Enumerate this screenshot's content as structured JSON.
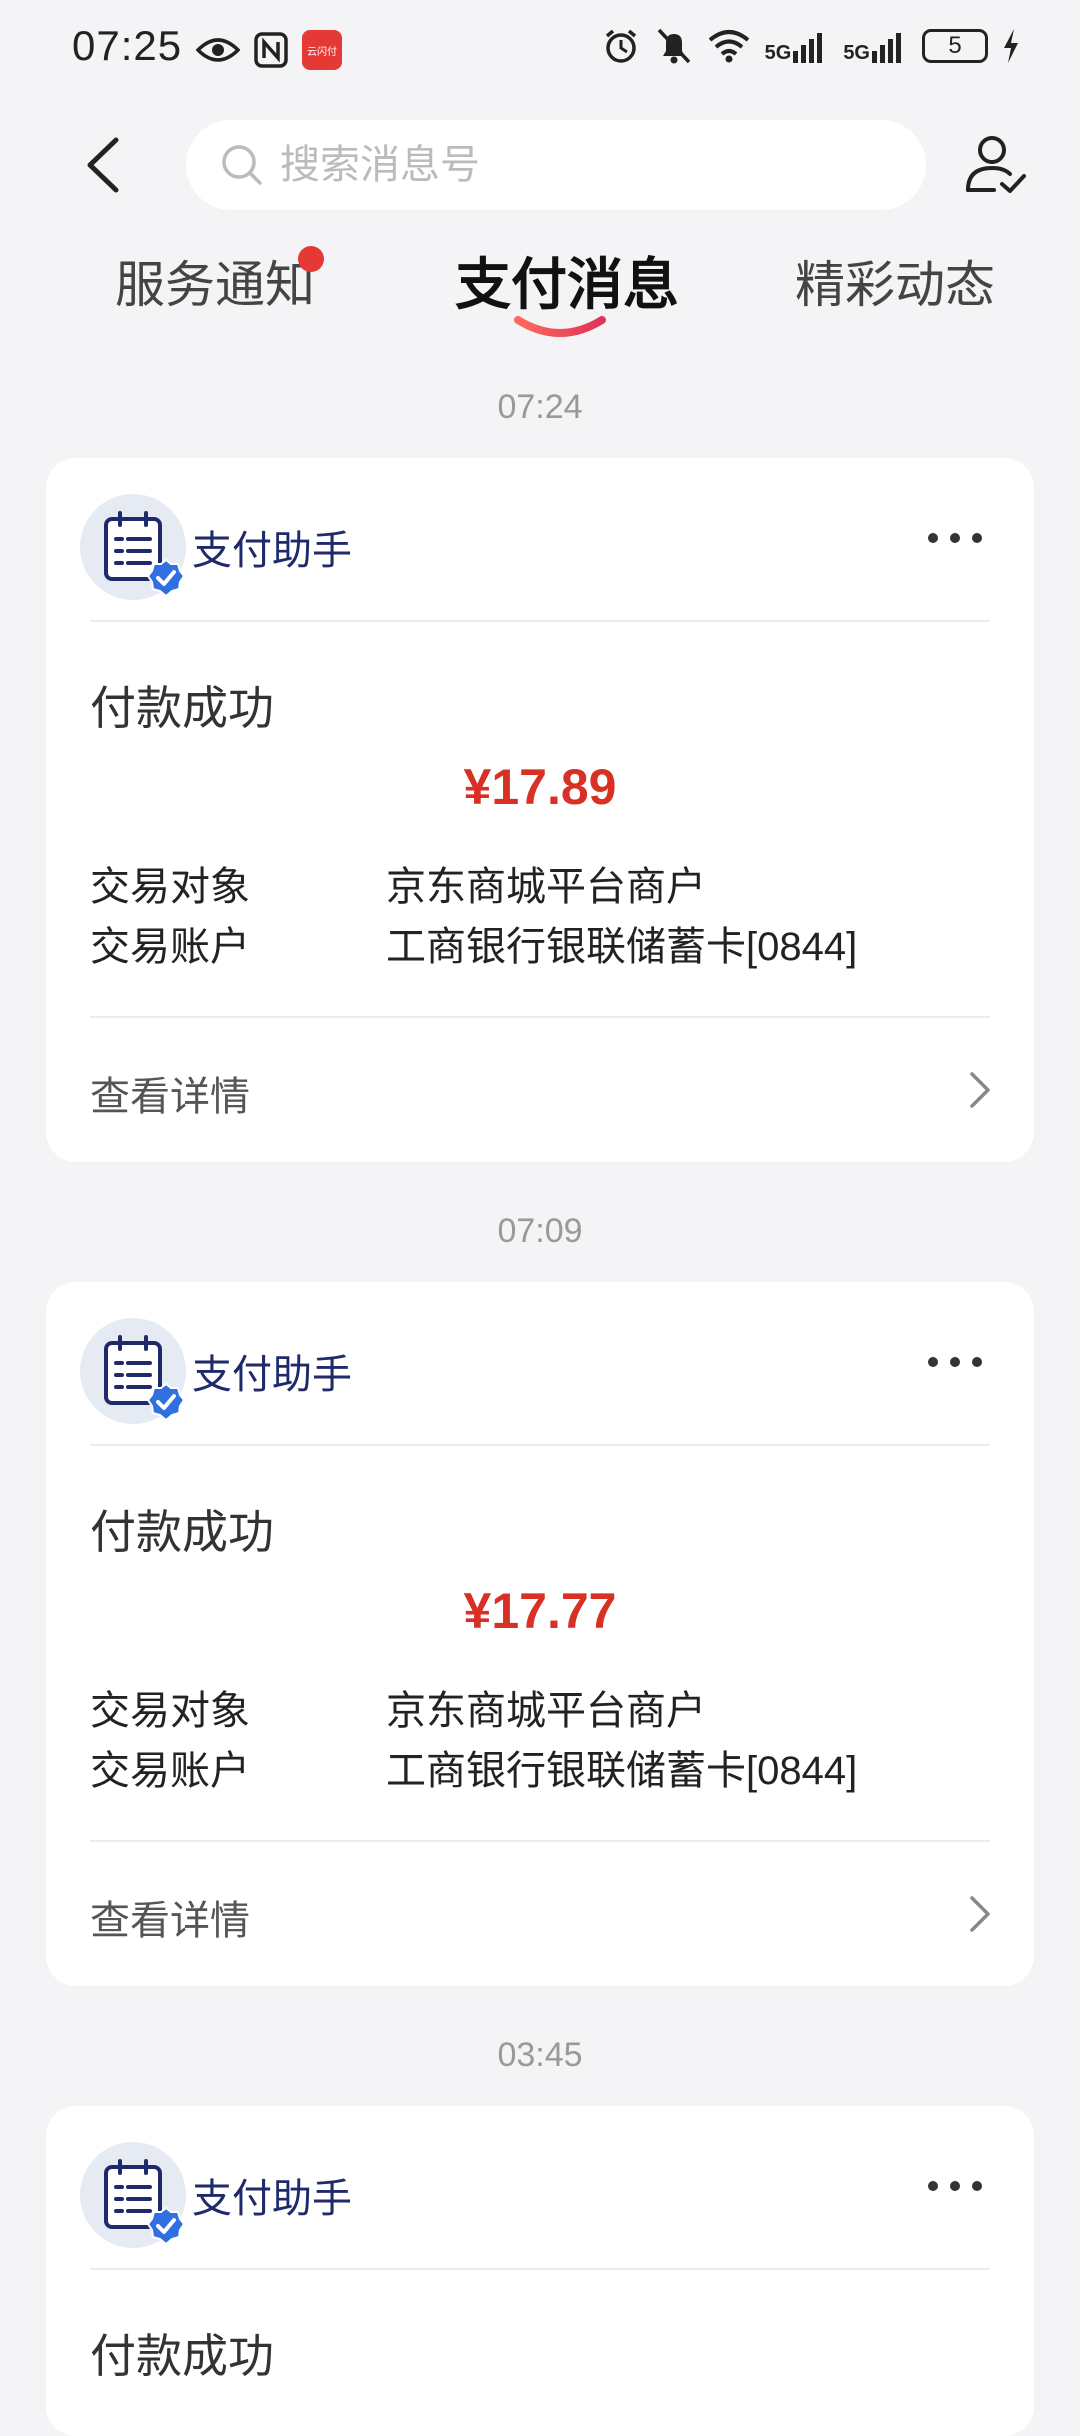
{
  "status_bar": {
    "time": "07:25",
    "network1": "5G",
    "network2": "5G",
    "battery": "5",
    "app_badge": "云闪付"
  },
  "header": {
    "search_placeholder": "搜索消息号"
  },
  "tabs": [
    {
      "label": "服务通知",
      "has_dot": true
    },
    {
      "label": "支付消息",
      "active": true
    },
    {
      "label": "精彩动态"
    }
  ],
  "messages": [
    {
      "time": "07:24",
      "sender": "支付助手",
      "title": "付款成功",
      "amount": "¥17.89",
      "rows": [
        {
          "k": "交易对象",
          "v": "京东商城平台商户"
        },
        {
          "k": "交易账户",
          "v": "工商银行银联储蓄卡[0844]"
        }
      ],
      "detail": "查看详情"
    },
    {
      "time": "07:09",
      "sender": "支付助手",
      "title": "付款成功",
      "amount": "¥17.77",
      "rows": [
        {
          "k": "交易对象",
          "v": "京东商城平台商户"
        },
        {
          "k": "交易账户",
          "v": "工商银行银联储蓄卡[0844]"
        }
      ],
      "detail": "查看详情"
    },
    {
      "time": "03:45",
      "sender": "支付助手",
      "title": "付款成功"
    }
  ],
  "colors": {
    "accent_red": "#d93025",
    "sender_blue": "#1f2a6b",
    "verified_blue": "#2f6fe0",
    "background": "#f4f4f6"
  }
}
